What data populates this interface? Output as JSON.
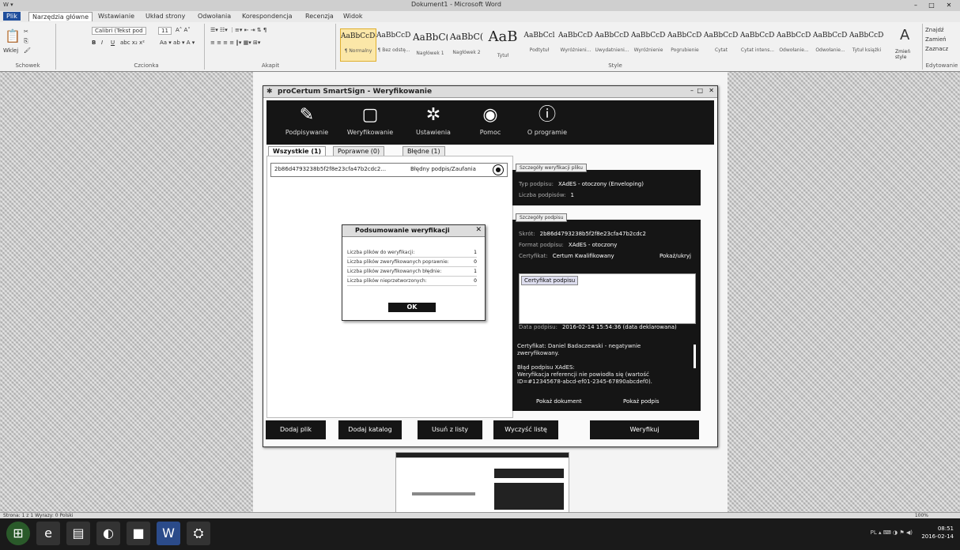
{
  "word": {
    "title": "Dokument1 - Microsoft Word",
    "window_controls": [
      "–",
      "□",
      "✕"
    ],
    "tabs": [
      "Plik",
      "Narzędzia główne",
      "Wstawianie",
      "Układ strony",
      "Odwołania",
      "Korespondencja",
      "Recenzja",
      "Widok"
    ],
    "clipboard_label": "Schowek",
    "paste_label": "Wklej",
    "font_name": "Calibri (Tekst pod",
    "font_size": "11",
    "font_label": "Czcionka",
    "paragraph_label": "Akapit",
    "styles_label": "Style",
    "styles": [
      {
        "sample": "AaBbCcDc",
        "name": "¶ Normalny"
      },
      {
        "sample": "AaBbCcDc",
        "name": "¶ Bez odstę..."
      },
      {
        "sample": "AaBbC(",
        "name": "Nagłówek 1"
      },
      {
        "sample": "AaBbC(",
        "name": "Nagłówek 2"
      },
      {
        "sample": "AaB",
        "name": "Tytuł"
      },
      {
        "sample": "AaBbCcl",
        "name": "Podtytuł"
      },
      {
        "sample": "AaBbCcDc",
        "name": "Wyróżnieni..."
      },
      {
        "sample": "AaBbCcDc",
        "name": "Uwydatnieni..."
      },
      {
        "sample": "AaBbCcDc",
        "name": "Wyróżnienie"
      },
      {
        "sample": "AaBbCcDc",
        "name": "Pogrubienie"
      },
      {
        "sample": "AaBbCcDc",
        "name": "Cytat"
      },
      {
        "sample": "AaBbCcDc",
        "name": "Cytat intens..."
      },
      {
        "sample": "AaBbCcDc",
        "name": "Odwołanie..."
      },
      {
        "sample": "AaBbCcDc",
        "name": "Odwołanie..."
      },
      {
        "sample": "AaBbCcDc",
        "name": "Tytuł książki"
      }
    ],
    "change_styles": "Zmień style",
    "edit_items": [
      "Znajdź",
      "Zamień",
      "Zaznacz"
    ],
    "editing_label": "Edytowanie",
    "status_left": "Strona: 1 z 1    Wyrazy: 0    Polski",
    "status_right": "100%"
  },
  "app": {
    "title": "proCertum SmartSign - Weryfikowanie",
    "toolbar": [
      {
        "icon": "edit-icon",
        "glyph": "✎",
        "label": "Podpisywanie"
      },
      {
        "icon": "verify-icon",
        "glyph": "▢",
        "label": "Weryfikowanie"
      },
      {
        "icon": "gear-icon",
        "glyph": "✲",
        "label": "Ustawienia"
      },
      {
        "icon": "help-icon",
        "glyph": "◉",
        "label": "Pomoc"
      },
      {
        "icon": "info-icon",
        "glyph": "ⓘ",
        "label": "O programie"
      }
    ],
    "tabs": [
      "Wszystkie (1)",
      "Poprawne (0)",
      "Błędne (1)"
    ],
    "file": {
      "name": "2b86d4793238b5f2f8e23cfa47b2cdc2...",
      "status": "Błędny podpis/Zaufania"
    },
    "summary": {
      "title": "Podsumowanie weryfikacji",
      "rows": [
        {
          "label": "Liczba plików do weryfikacji:",
          "value": "1"
        },
        {
          "label": "Liczba plików zweryfikowanych poprawnie:",
          "value": "0"
        },
        {
          "label": "Liczba plików zweryfikowanych błędnie:",
          "value": "1"
        },
        {
          "label": "Liczba plików nieprzetworzonych:",
          "value": "0"
        }
      ],
      "ok": "OK"
    },
    "sig_panel": {
      "title": "Szczegóły weryfikacji pliku",
      "rows": [
        {
          "k": "Typ podpisu:",
          "v": "XAdES - otoczony (Enveloping)"
        },
        {
          "k": "Liczba podpisów:",
          "v": "1"
        }
      ]
    },
    "cert_panel": {
      "title": "Szczegóły podpisu",
      "rows": [
        {
          "k": "Skrót:",
          "v": "2b86d4793238b5f2f8e23cfa47b2cdc2"
        },
        {
          "k": "Format podpisu:",
          "v": "XAdES - otoczony"
        },
        {
          "k": "Certyfikat:",
          "v": "Certum Kwalifikowany"
        }
      ],
      "view": "Pokaż/ukryj",
      "cert_item": "Certyfikat podpisu",
      "date_label": "Data podpisu:",
      "date_value": "2016-02-14 15:54:36 (data deklarowana)",
      "messages": [
        "Certyfikat: Daniel Badaczewski - negatywnie",
        "zweryfikowany.",
        "",
        "Błąd podpisu XAdES:",
        "Weryfikacja referencji nie powiodła się (wartość",
        "ID=#12345678-abcd-ef01-2345-67890abcdef0)."
      ],
      "show_document": "Pokaż dokument",
      "show_signature": "Pokaż podpis"
    },
    "bottom": [
      "Dodaj plik",
      "Dodaj katalog",
      "Usuń z listy",
      "Wyczyść listę",
      "Weryfikuj"
    ]
  },
  "taskbar": {
    "apps": [
      "⊞",
      "e",
      "▤",
      "◐",
      "■",
      "W",
      "⛭"
    ],
    "tray": "PL ▴ ⌨ ◑ ⚑ ◀)",
    "time": "08:51",
    "date": "2016-02-14"
  }
}
